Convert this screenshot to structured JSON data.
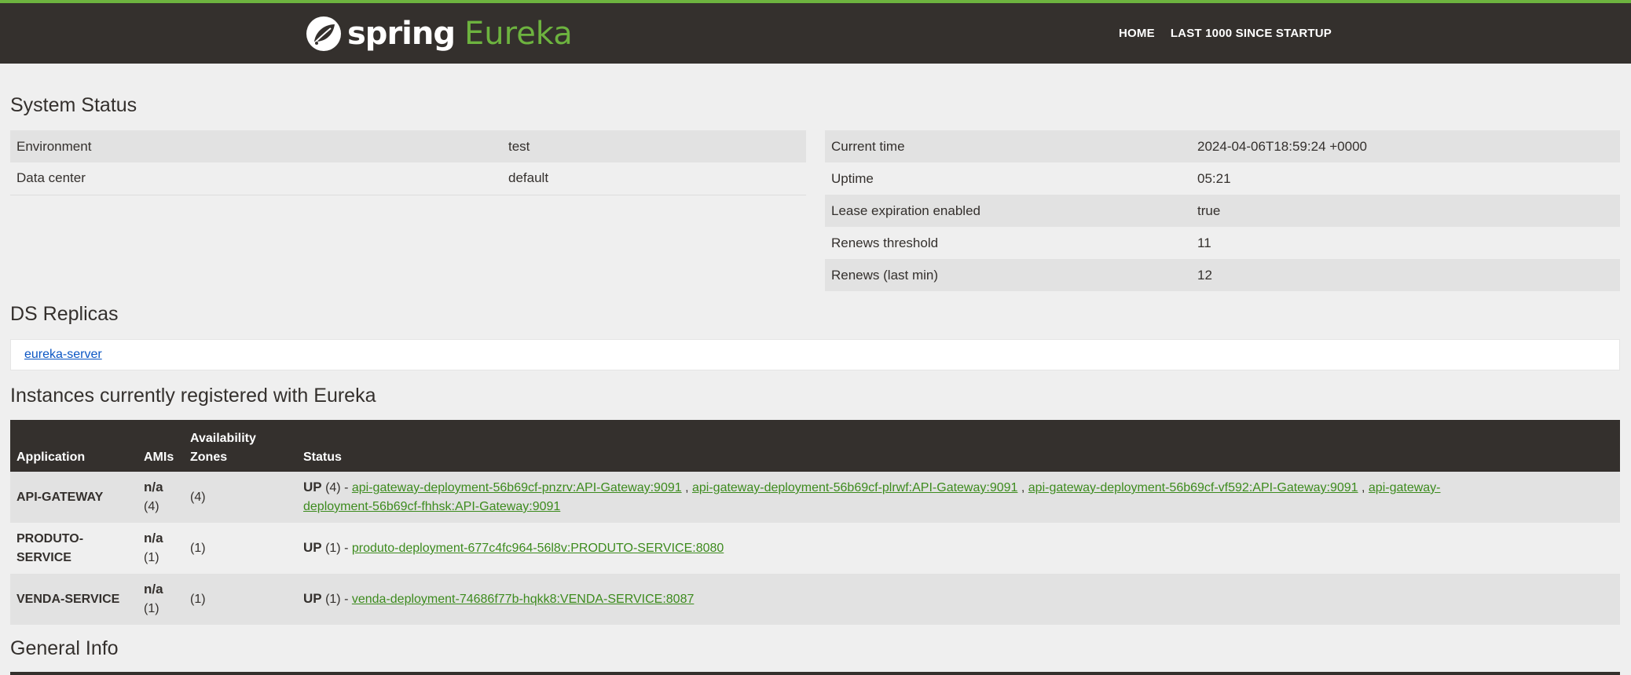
{
  "header": {
    "logo_spring": "spring",
    "logo_eureka": "Eureka",
    "nav": [
      {
        "label": "HOME"
      },
      {
        "label": "LAST 1000 SINCE STARTUP"
      }
    ]
  },
  "system_status": {
    "title": "System Status",
    "left": [
      {
        "key": "Environment",
        "value": "test"
      },
      {
        "key": "Data center",
        "value": "default"
      }
    ],
    "right": [
      {
        "key": "Current time",
        "value": "2024-04-06T18:59:24 +0000"
      },
      {
        "key": "Uptime",
        "value": "05:21"
      },
      {
        "key": "Lease expiration enabled",
        "value": "true"
      },
      {
        "key": "Renews threshold",
        "value": "11"
      },
      {
        "key": "Renews (last min)",
        "value": "12"
      }
    ]
  },
  "ds_replicas": {
    "title": "DS Replicas",
    "replica": "eureka-server"
  },
  "instances": {
    "title": "Instances currently registered with Eureka",
    "columns": {
      "application": "Application",
      "amis": "AMIs",
      "zones_1": "Availability",
      "zones_2": "Zones",
      "status": "Status"
    },
    "rows": [
      {
        "app": "API-GATEWAY",
        "amis_na": "n/a",
        "amis_count": "(4)",
        "zones": "(4)",
        "status_up": "UP",
        "status_count": "(4) -",
        "links": [
          "api-gateway-deployment-56b69cf-pnzrv:API-Gateway:9091",
          "api-gateway-deployment-56b69cf-plrwf:API-Gateway:9091",
          "api-gateway-deployment-56b69cf-vf592:API-Gateway:9091",
          "api-gateway-deployment-56b69cf-fhhsk:API-Gateway:9091"
        ],
        "link4_line1": "api-gateway-",
        "link4_line2": "deployment-56b69cf-fhhsk:API-Gateway:9091"
      },
      {
        "app_line1": "PRODUTO-",
        "app_line2": "SERVICE",
        "amis_na": "n/a",
        "amis_count": "(1)",
        "zones": "(1)",
        "status_up": "UP",
        "status_count": "(1) -",
        "link": "produto-deployment-677c4fc964-56l8v:PRODUTO-SERVICE:8080"
      },
      {
        "app": "VENDA-SERVICE",
        "amis_na": "n/a",
        "amis_count": "(1)",
        "zones": "(1)",
        "status_up": "UP",
        "status_count": "(1) -",
        "link": "venda-deployment-74686f77b-hqkk8:VENDA-SERVICE:8087"
      }
    ]
  },
  "general_info": {
    "title": "General Info"
  },
  "colors": {
    "header_bg": "#34302d",
    "brand_green": "#6db33f",
    "link_green": "#3d8b1e",
    "link_blue": "#0b56c4"
  }
}
